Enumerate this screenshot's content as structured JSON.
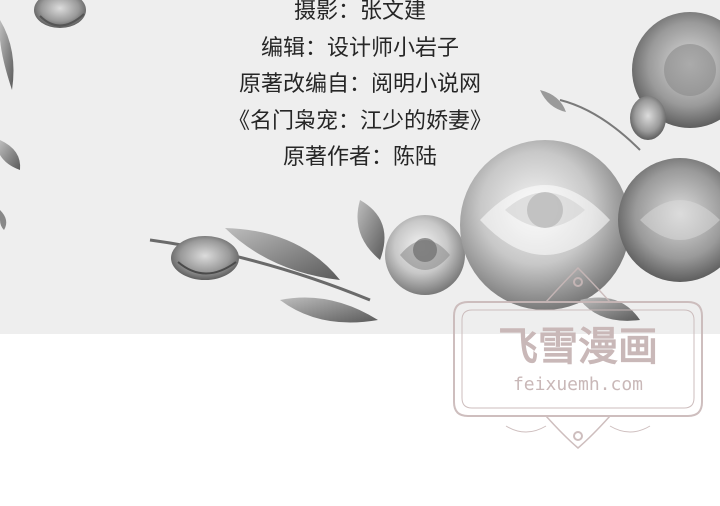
{
  "credits": {
    "line_1": "摄影：张文建",
    "line_2": "编辑：设计师小岩子",
    "line_3": "原著改编自：阅明小说网",
    "line_4": "《名门枭宠：江少的娇妻》",
    "line_5": "原著作者：陈陆"
  },
  "watermark": {
    "title": "飞雪漫画",
    "url": "feixuemh.com"
  },
  "colors": {
    "band_background": "#eeeeee",
    "page_background": "#ffffff",
    "text": "#262626",
    "watermark": "#c9b8b8"
  }
}
